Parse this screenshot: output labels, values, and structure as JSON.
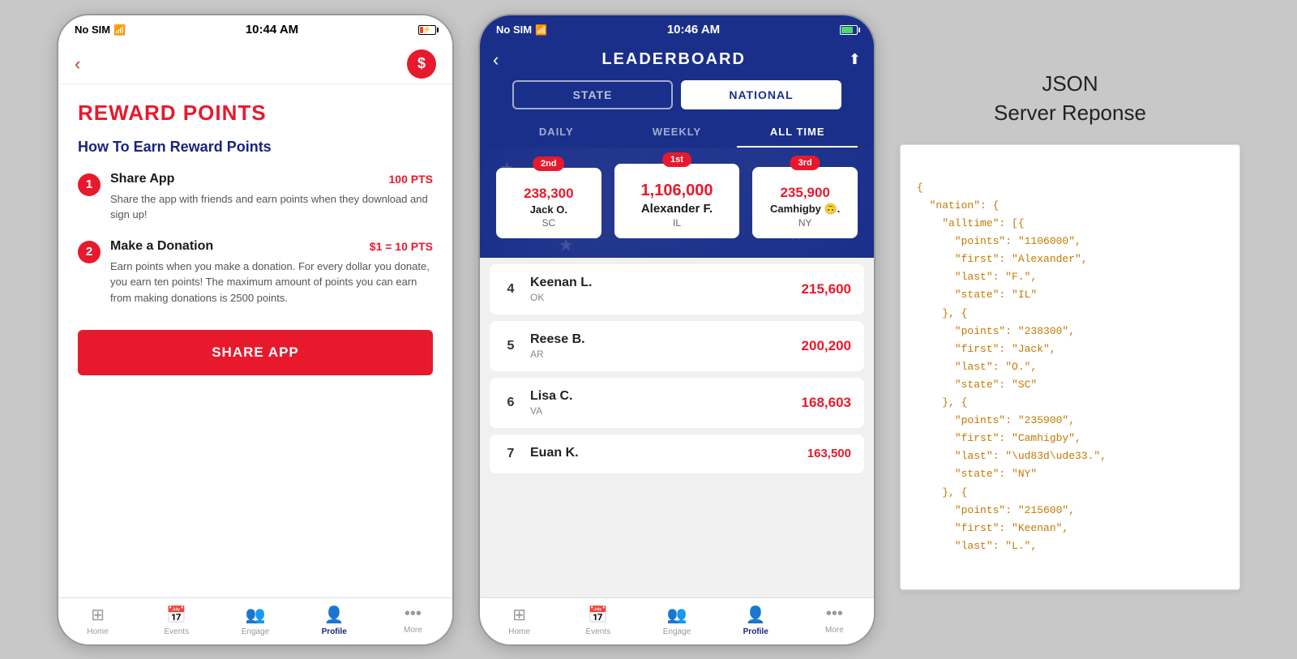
{
  "screen1": {
    "status": {
      "carrier": "No SIM",
      "time": "10:44 AM"
    },
    "title": "REWARD POINTS",
    "subtitle": "How To Earn Reward Points",
    "earn_items": [
      {
        "number": "1",
        "name": "Share App",
        "points": "100 PTS",
        "description": "Share the app with friends and earn points when they download and sign up!"
      },
      {
        "number": "2",
        "name": "Make a Donation",
        "points": "$1 = 10 PTS",
        "description": "Earn points when you make a donation. For every dollar you donate, you earn ten points! The maximum amount of points you can earn from making donations is 2500 points."
      }
    ],
    "share_button": "SHARE APP",
    "tabs": [
      {
        "icon": "⊞",
        "label": "Home",
        "active": false
      },
      {
        "icon": "📅",
        "label": "Events",
        "active": false
      },
      {
        "icon": "👥",
        "label": "Engage",
        "active": false
      },
      {
        "icon": "👤",
        "label": "Profile",
        "active": true
      },
      {
        "icon": "•••",
        "label": "More",
        "active": false
      }
    ]
  },
  "screen2": {
    "status": {
      "carrier": "No SIM",
      "time": "10:46 AM"
    },
    "title": "LEADERBOARD",
    "toggle_buttons": [
      "STATE",
      "NATIONAL"
    ],
    "active_toggle": "NATIONAL",
    "time_tabs": [
      "DAILY",
      "WEEKLY",
      "ALL TIME"
    ],
    "active_tab": "ALL TIME",
    "podium": [
      {
        "rank": "1st",
        "points": "1,106,000",
        "name": "Alexander F.",
        "state": "IL",
        "position": "first"
      },
      {
        "rank": "2nd",
        "points": "238,300",
        "name": "Jack O.",
        "state": "SC",
        "position": "second"
      },
      {
        "rank": "3rd",
        "points": "235,900",
        "name": "Camhigby 🙃.",
        "state": "NY",
        "position": "third"
      }
    ],
    "list": [
      {
        "rank": "4",
        "name": "Keenan L.",
        "state": "OK",
        "score": "215,600"
      },
      {
        "rank": "5",
        "name": "Reese B.",
        "state": "AR",
        "score": "200,200"
      },
      {
        "rank": "6",
        "name": "Lisa C.",
        "state": "VA",
        "score": "168,603"
      },
      {
        "rank": "7",
        "name": "Euan K.",
        "state": "",
        "score": "163,500"
      }
    ],
    "tabs": [
      {
        "icon": "⊞",
        "label": "Home",
        "active": false
      },
      {
        "icon": "📅",
        "label": "Events",
        "active": false
      },
      {
        "icon": "👥",
        "label": "Engage",
        "active": false
      },
      {
        "icon": "👤",
        "label": "Profile",
        "active": true
      },
      {
        "icon": "•••",
        "label": "More",
        "active": false
      }
    ]
  },
  "json_panel": {
    "title_line1": "JSON",
    "title_line2": "Server Reponse",
    "content": "{\n  \"nation\": {\n    \"alltime\": [{\n      \"points\": \"1106000\",\n      \"first\": \"Alexander\",\n      \"last\": \"F.\",\n      \"state\": \"IL\"\n    }, {\n      \"points\": \"238300\",\n      \"first\": \"Jack\",\n      \"last\": \"O.\",\n      \"state\": \"SC\"\n    }, {\n      \"points\": \"235900\",\n      \"first\": \"Camhigby\",\n      \"last\": \"\\ud83d\\ude33.\",\n      \"state\": \"NY\"\n    }, {\n      \"points\": \"215600\",\n      \"first\": \"Keenan\",\n      \"last\": \"L.\","
  }
}
